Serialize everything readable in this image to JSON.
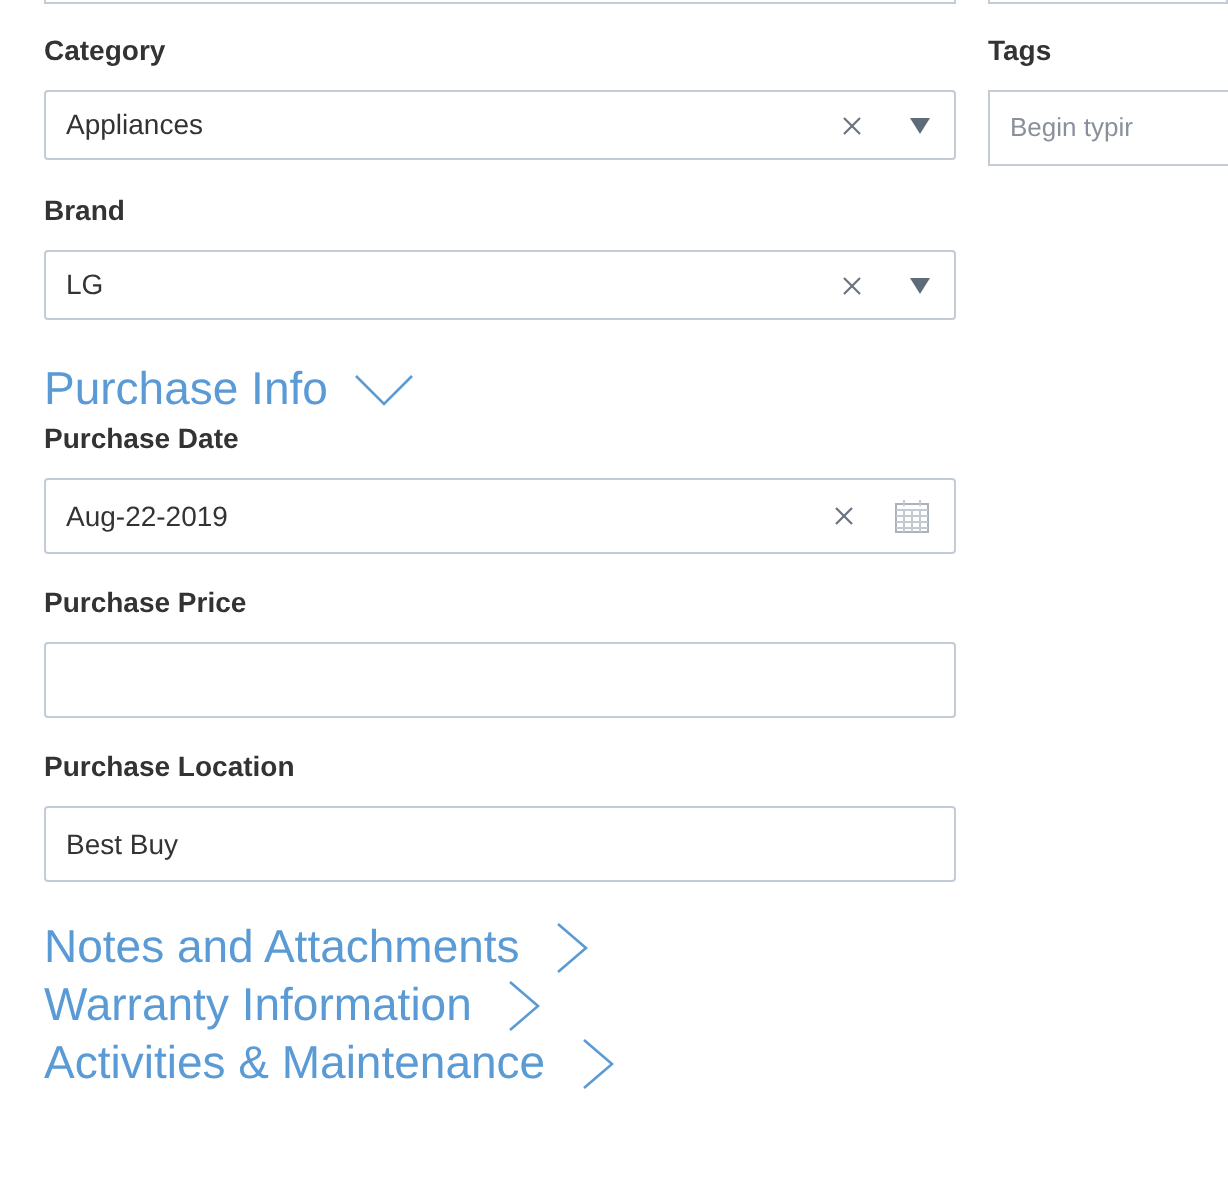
{
  "main_fields": [
    {
      "kind": "select",
      "label": "Category",
      "value": "Appliances"
    },
    {
      "kind": "select",
      "label": "Brand",
      "value": "LG"
    }
  ],
  "tags": {
    "label": "Tags",
    "placeholder": "Begin typir"
  },
  "sections": [
    {
      "title": "Purchase Info",
      "expanded": true,
      "fields": [
        {
          "kind": "date",
          "label": "Purchase Date",
          "value": "Aug-22-2019"
        },
        {
          "kind": "text",
          "label": "Purchase Price"
        },
        {
          "kind": "text",
          "label": "Purchase Location",
          "value": "Best Buy"
        }
      ]
    },
    {
      "title": "Notes and Attachments",
      "expanded": false
    },
    {
      "title": "Warranty Information",
      "expanded": false
    },
    {
      "title": "Activities & Maintenance",
      "expanded": false
    }
  ]
}
